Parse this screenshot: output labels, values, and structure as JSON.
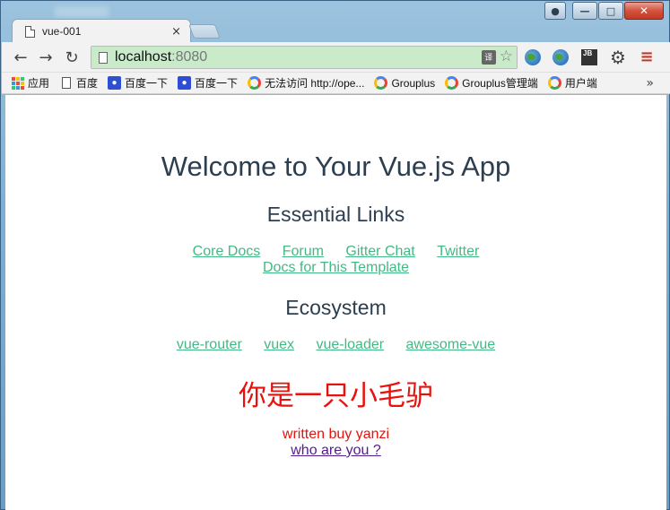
{
  "window": {
    "caption_buttons": {
      "user": "user-icon",
      "minimize": "minimize-icon",
      "maximize": "maximize-icon",
      "close": "close-icon"
    }
  },
  "tab": {
    "title": "vue-001",
    "close_glyph": "×"
  },
  "toolbar": {
    "back_glyph": "←",
    "forward_glyph": "→",
    "reload_glyph": "↻",
    "url_host": "localhost",
    "url_port": ":8080",
    "translate_glyph": "译",
    "star_glyph": "☆",
    "jb_label": "JB",
    "settings_glyph": "⚙",
    "menu_glyph": "≡"
  },
  "bookmarks": {
    "items": [
      {
        "label": "应用",
        "icon": "apps-grid-icon"
      },
      {
        "label": "百度",
        "icon": "page-icon"
      },
      {
        "label": "百度一下",
        "icon": "baidu-paw-icon"
      },
      {
        "label": "百度一下",
        "icon": "baidu-paw-icon"
      },
      {
        "label": "无法访问 http://ope...",
        "icon": "g-icon"
      },
      {
        "label": "Grouplus",
        "icon": "g-icon"
      },
      {
        "label": "Grouplus管理端",
        "icon": "g-icon"
      },
      {
        "label": "用户端",
        "icon": "g-icon"
      }
    ],
    "more_glyph": "»"
  },
  "page": {
    "title": "Welcome to Your Vue.js App",
    "essential_heading": "Essential Links",
    "essential_links": [
      "Core Docs",
      "Forum",
      "Gitter Chat",
      "Twitter"
    ],
    "template_link": "Docs for This Template",
    "ecosystem_heading": "Ecosystem",
    "ecosystem_links": [
      "vue-router",
      "vuex",
      "vue-loader",
      "awesome-vue"
    ],
    "chinese_title": "你是一只小毛驴",
    "author": "written buy yanzi",
    "who_link": "who are you ?"
  },
  "colors": {
    "link_green": "#42b983",
    "heading": "#2c3e50",
    "red_text": "#e8110c",
    "visited_link": "#551a8b",
    "omnibox_secure": "#c9ebc9"
  }
}
